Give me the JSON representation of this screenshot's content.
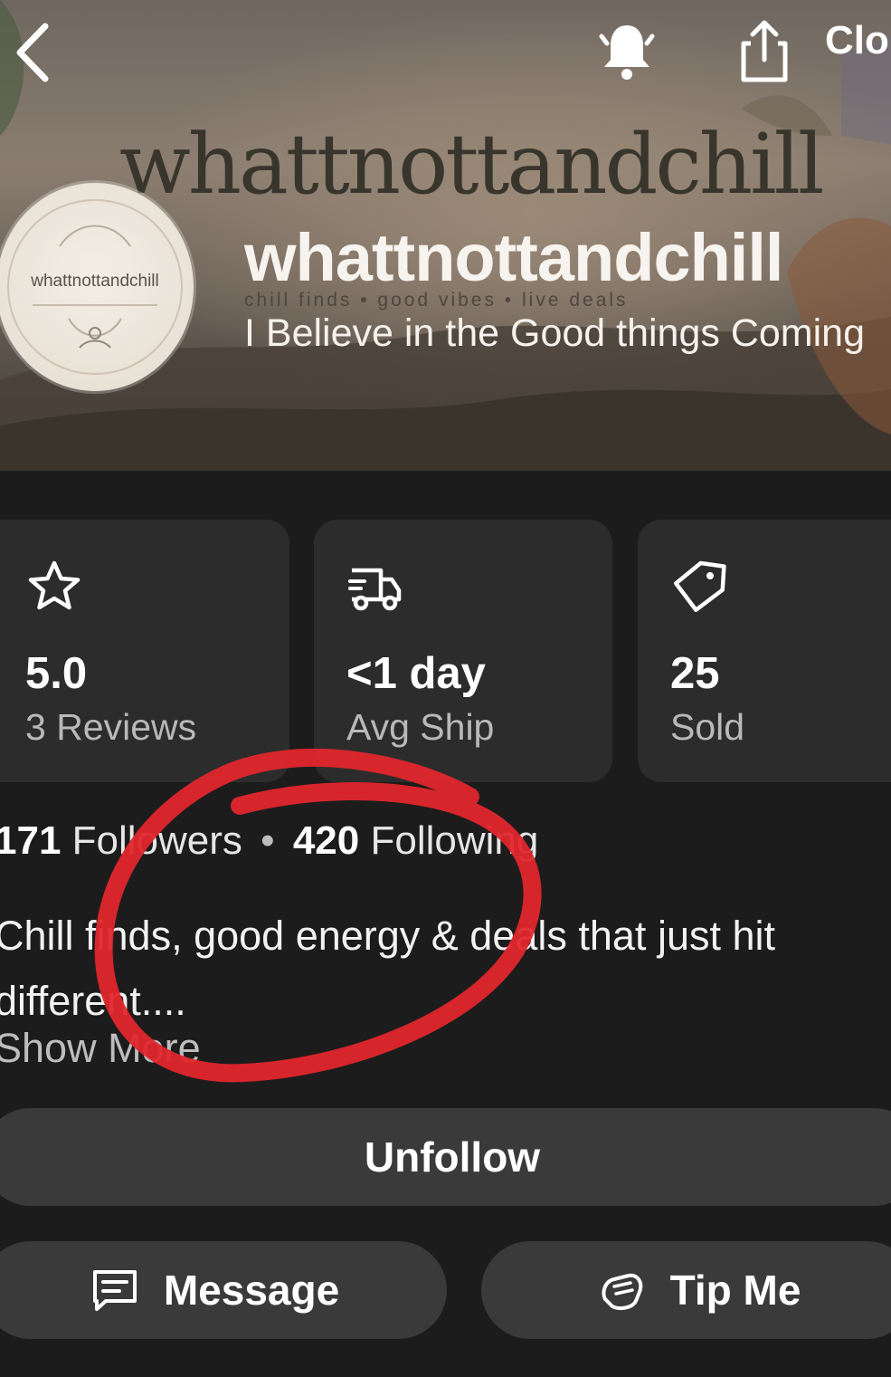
{
  "header": {
    "close_label": "Clo",
    "banner_script": "whattnottandchill",
    "store_name": "whattnottandchill",
    "tagline": "chill finds • good vibes • live deals",
    "bio": "I Believe in the Good things Coming",
    "avatar_text": "whattnottandchill",
    "icons": [
      "back-icon",
      "bell-icon",
      "share-icon"
    ]
  },
  "stats": [
    {
      "icon": "star-icon",
      "value": "5.0",
      "label": "3 Reviews"
    },
    {
      "icon": "truck-icon",
      "value": "<1 day",
      "label": "Avg Ship"
    },
    {
      "icon": "tag-icon",
      "value": "25",
      "label": "Sold"
    }
  ],
  "follow": {
    "followers_count": "171",
    "followers_label": "Followers",
    "separator": "•",
    "following_count": "420",
    "following_label": "Following"
  },
  "description": {
    "text": "Chill finds, good energy & deals that just hit different....",
    "show_more": "Show More"
  },
  "actions": {
    "unfollow": "Unfollow",
    "message": "Message",
    "tip": "Tip Me"
  },
  "colors": {
    "background": "#1c1c1c",
    "card": "#2c2c2c",
    "button": "#3a3a3a",
    "annotation_red": "#e0262c"
  }
}
